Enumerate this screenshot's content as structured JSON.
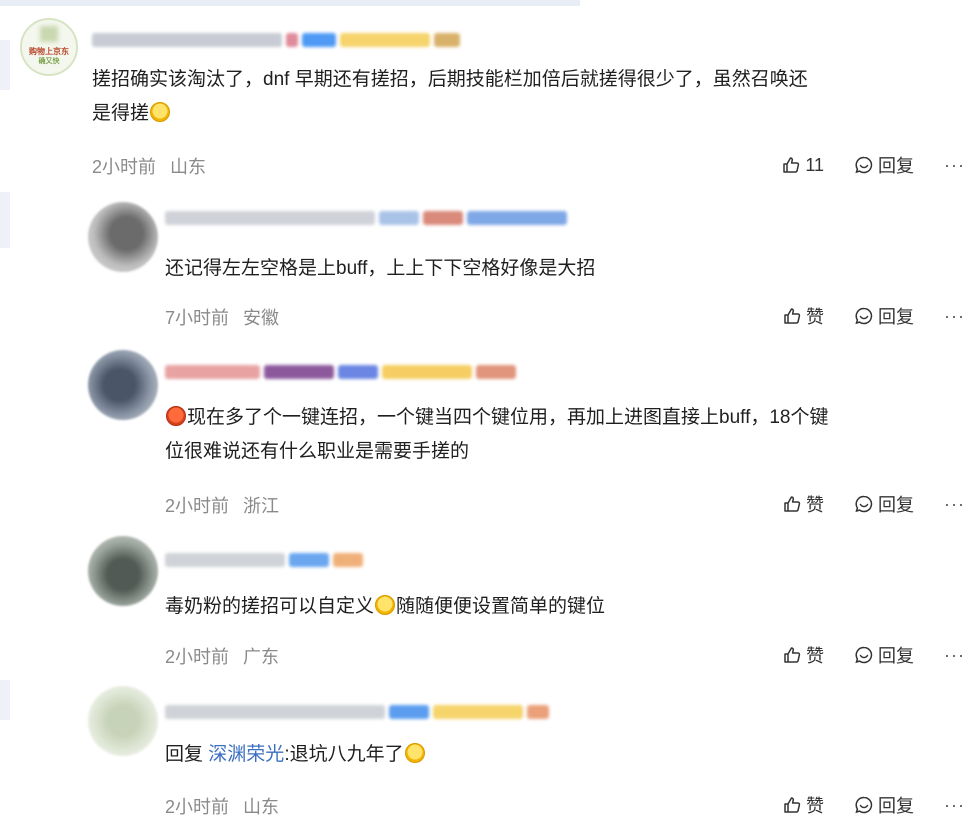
{
  "comments": [
    {
      "text": "搓招确实该淘汰了，dnf 早期还有搓招，后期技能栏加倍后就搓得很少了，虽然召唤还是得搓",
      "text_line1": "搓招确实该淘汰了，dnf 早期还有搓招，后期技能栏加倍后就搓得很少了，虽然召唤还",
      "text_line2": "是得搓",
      "emoji": "smile-emoji",
      "time": "2小时前",
      "location": "山东",
      "like_label": "11",
      "reply_label": "回复",
      "more_label": "···",
      "avatar_text_1": "购物上京东",
      "avatar_text_2": "确又快"
    },
    {
      "text": "还记得左左空格是上buff，上上下下空格好像是大招",
      "time": "7小时前",
      "location": "安徽",
      "like_label": "赞",
      "reply_label": "回复",
      "more_label": "···"
    },
    {
      "text_line1": "现在多了个一键连招，一个键当四个键位用，再加上进图直接上buff，18个键",
      "text_line2": "位很难说还有什么职业是需要手搓的",
      "emoji": "angry-emoji",
      "time": "2小时前",
      "location": "浙江",
      "like_label": "赞",
      "reply_label": "回复",
      "more_label": "···"
    },
    {
      "text_before": "毒奶粉的搓招可以自定义",
      "text_after": "随随便便设置简单的键位",
      "emoji": "smile-emoji",
      "time": "2小时前",
      "location": "广东",
      "like_label": "赞",
      "reply_label": "回复",
      "more_label": "···"
    },
    {
      "reply_prefix": "回复",
      "reply_to": "深渊荣光",
      "text": ":退坑八九年了",
      "emoji": "smile-emoji",
      "time": "2小时前",
      "location": "山东",
      "like_label": "赞",
      "reply_label": "回复",
      "more_label": "···"
    }
  ],
  "colors": {
    "link": "#3b6fc2",
    "meta": "#8a8a8a",
    "text": "#1f1f1f"
  }
}
